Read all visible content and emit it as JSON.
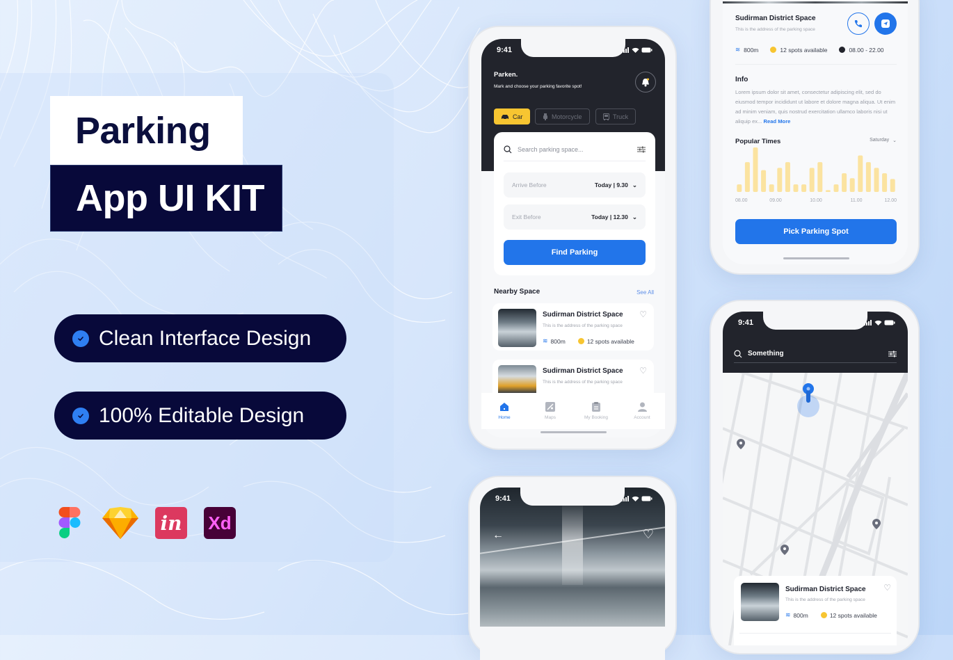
{
  "promo": {
    "title_line1": "Parking",
    "title_line2": "App UI KIT",
    "features": [
      "Clean Interface Design",
      "100% Editable Design"
    ],
    "tools": [
      {
        "name": "figma",
        "label": ""
      },
      {
        "name": "sketch",
        "label": ""
      },
      {
        "name": "invision",
        "label": "in"
      },
      {
        "name": "adobe-xd",
        "label": "Xd"
      }
    ]
  },
  "colors": {
    "accent_blue": "#2275ea",
    "accent_yellow": "#f7c531",
    "dark": "#22242c",
    "navy": "#08093a",
    "bar_yellow": "#fbe3a0"
  },
  "home_screen": {
    "time": "9:41",
    "brand": "Parken.",
    "tagline": "Mark and choose your parking favorite spot!",
    "vehicle_tabs": [
      {
        "label": "Car",
        "icon": "car-icon",
        "active": true
      },
      {
        "label": "Motorcycle",
        "icon": "motorcycle-icon",
        "active": false
      },
      {
        "label": "Truck",
        "icon": "truck-icon",
        "active": false
      }
    ],
    "search_placeholder": "Search parking space...",
    "arrive": {
      "label": "Arrive Before",
      "value": "Today | 9.30"
    },
    "exit": {
      "label": "Exit Before",
      "value": "Today | 12.30"
    },
    "find_button": "Find Parking",
    "nearby_title": "Nearby Space",
    "see_all": "See All",
    "nearby": [
      {
        "name": "Sudirman District Space",
        "address": "This is the address of the parking space",
        "distance": "800m",
        "spots": "12 spots available"
      },
      {
        "name": "Sudirman District Space",
        "address": "This is the address of the parking space",
        "distance": "",
        "spots": ""
      }
    ],
    "nav": [
      {
        "label": "Home",
        "icon": "home-icon",
        "active": true
      },
      {
        "label": "Maps",
        "icon": "map-icon",
        "active": false
      },
      {
        "label": "My Booking",
        "icon": "booking-icon",
        "active": false
      },
      {
        "label": "Account",
        "icon": "account-icon",
        "active": false
      }
    ]
  },
  "detail_screen": {
    "name": "Sudirman District Space",
    "address": "This is the address of the parking space",
    "distance": "800m",
    "spots": "12 spots available",
    "hours": "08.00 - 22.00",
    "info_title": "Info",
    "info_text": "Lorem ipsum dolor sit amet, consectetur adipiscing elit, sed do eiusmod tempor incididunt ut labore et dolore magna aliqua. Ut enim ad minim veniam, quis nostrud exercitation ullamco laboris nisi ut aliquip ex...",
    "read_more": "Read More",
    "popular_title": "Popular Times",
    "day_select": "Saturday",
    "pick_button": "Pick Parking Spot"
  },
  "chart_data": {
    "type": "bar",
    "title": "Popular Times",
    "xlabel": "",
    "ylabel": "",
    "tick_labels": [
      "08.00",
      "09.00",
      "10.00",
      "11.00",
      "12.00"
    ],
    "values": [
      0.17,
      0.67,
      1.0,
      0.49,
      0.17,
      0.54,
      0.67,
      0.17,
      0.17,
      0.54,
      0.67,
      0.04,
      0.17,
      0.42,
      0.31,
      0.82,
      0.67,
      0.54,
      0.42,
      0.29
    ],
    "ylim": [
      0,
      1
    ],
    "grid": false
  },
  "photo_screen": {
    "time": "9:41"
  },
  "map_screen": {
    "time": "9:41",
    "search_value": "Something",
    "card": {
      "name": "Sudirman District Space",
      "address": "This is the address of the parking space",
      "distance": "800m",
      "spots": "12 spots available"
    }
  }
}
